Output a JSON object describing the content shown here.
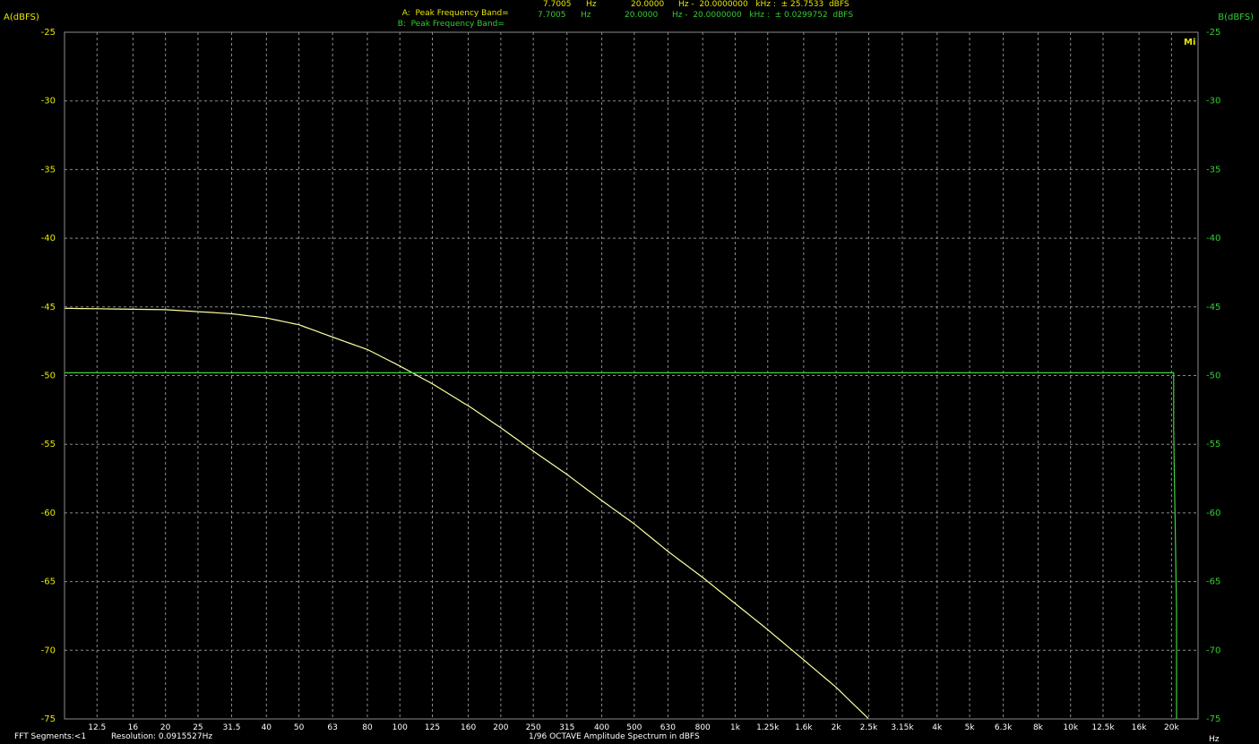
{
  "header": {
    "line_a": {
      "label": "A:  Peak Frequency Band=",
      "value": "7.7005",
      "unit": "Hz",
      "range_start": "20.0000",
      "range_text": "Hz -  20.0000000   kHz :  ± 25.7533  dBFS"
    },
    "line_b": {
      "label": "B:  Peak Frequency Band=",
      "value": "7.7005",
      "unit": "Hz",
      "range_start": "20.0000",
      "range_text": "Hz -  20.0000000   kHz :  ± 0.0299752  dBFS"
    }
  },
  "footer": {
    "segments": "FFT Segments:<1",
    "resolution": "Resolution: 0.0915527Hz",
    "x_title": "1/96 OCTAVE Amplitude Spectrum in dBFS",
    "x_unit": "Hz"
  },
  "logo_text": "Mi",
  "colors": {
    "background": "#000000",
    "grid": "#8c8c8c",
    "channel_a": "#e6e600",
    "channel_b": "#33cc33",
    "trace_a": "#ffffa0",
    "trace_b": "#3fd23f"
  },
  "chart_data": {
    "type": "line",
    "title": "1/96 OCTAVE Amplitude Spectrum in dBFS",
    "xlabel": "Hz",
    "ylabel_left": "A(dBFS)",
    "ylabel_right": "B(dBFS)",
    "x_scale": "log",
    "xlim": [
      10,
      24000
    ],
    "ylim": [
      -75,
      -25
    ],
    "y_ticks": [
      -25,
      -30,
      -35,
      -40,
      -45,
      -50,
      -55,
      -60,
      -65,
      -70,
      -75
    ],
    "x_ticks": [
      12.5,
      16,
      20,
      25,
      31.5,
      40,
      50,
      63,
      80,
      100,
      125,
      160,
      200,
      250,
      315,
      400,
      500,
      630,
      800,
      1000,
      1250,
      1600,
      2000,
      2500,
      3150,
      4000,
      5000,
      6300,
      8000,
      10000,
      12500,
      16000,
      20000
    ],
    "x_tick_labels": [
      "12.5",
      "16",
      "20",
      "25",
      "31.5",
      "40",
      "50",
      "63",
      "80",
      "100",
      "125",
      "160",
      "200",
      "250",
      "315",
      "400",
      "500",
      "630",
      "800",
      "1k",
      "1.25k",
      "1.6k",
      "2k",
      "2.5k",
      "3.15k",
      "4k",
      "5k",
      "6.3k",
      "8k",
      "10k",
      "12.5k",
      "16k",
      "20k"
    ],
    "grid": true,
    "series": [
      {
        "name": "A",
        "color": "#ffffa0",
        "x": [
          10,
          20,
          31.5,
          40,
          50,
          63,
          80,
          100,
          125,
          160,
          200,
          250,
          315,
          400,
          500,
          630,
          800,
          1000,
          1250,
          1600,
          2000,
          2500
        ],
        "y": [
          -45.1,
          -45.2,
          -45.5,
          -45.8,
          -46.3,
          -47.2,
          -48.1,
          -49.3,
          -50.6,
          -52.2,
          -53.8,
          -55.5,
          -57.2,
          -59.1,
          -60.8,
          -62.8,
          -64.7,
          -66.6,
          -68.5,
          -70.7,
          -72.7,
          -75
        ]
      },
      {
        "name": "B",
        "color": "#3fd23f",
        "x": [
          10,
          100,
          1000,
          10000,
          20300,
          20300,
          20700,
          20700
        ],
        "y": [
          -49.8,
          -49.8,
          -49.8,
          -49.8,
          -49.8,
          -54,
          -67,
          -75
        ]
      }
    ]
  }
}
